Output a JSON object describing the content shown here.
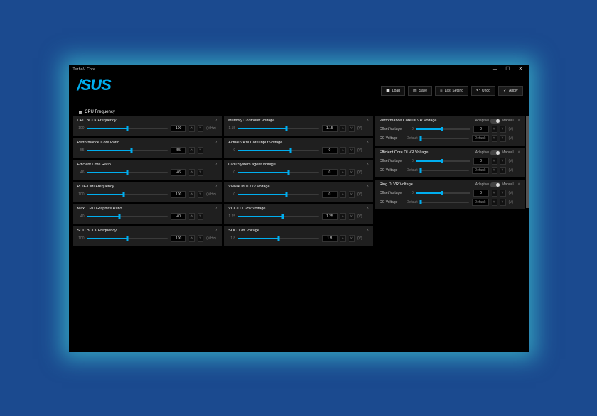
{
  "window": {
    "title": "TurboV Core"
  },
  "logo_text": "/SUS",
  "toolbar": {
    "load": "Load",
    "save": "Save",
    "last_setting": "Last Setting",
    "undo": "Undo",
    "apply": "Apply"
  },
  "tabs": {
    "cpu_freq": "CPU Frequency"
  },
  "units": {
    "mhz": "(MHz)",
    "v": "(V)"
  },
  "col1": [
    {
      "title": "CPU BCLK Frequency",
      "min": "100",
      "val": "100",
      "fill": 50,
      "unit": "(MHz)"
    },
    {
      "title": "Performance Core Ratio",
      "min": "55",
      "val": "55",
      "fill": 55,
      "unit": ""
    },
    {
      "title": "Efficient Core Ratio",
      "min": "46",
      "val": "46",
      "fill": 50,
      "unit": ""
    },
    {
      "title": "PCIE/DMI Frequency",
      "min": "100",
      "val": "100",
      "fill": 45,
      "unit": "(MHz)"
    },
    {
      "title": "Max. CPU Graphics Ratio",
      "min": "40",
      "val": "40",
      "fill": 40,
      "unit": ""
    },
    {
      "title": "SOC BCLK Frequency",
      "min": "100",
      "val": "100",
      "fill": 50,
      "unit": "(MHz)"
    }
  ],
  "col2": [
    {
      "title": "Memory Controller Voltage",
      "min": "1.15",
      "val": "1.15",
      "fill": 60,
      "unit": "(V)"
    },
    {
      "title": "Actual VRM Core Input Voltage",
      "min": "0",
      "val": "0",
      "fill": 65,
      "unit": "(V)"
    },
    {
      "title": "CPU System agent Voltage",
      "min": "0",
      "val": "0",
      "fill": 62,
      "unit": "(V)"
    },
    {
      "title": "VNNAON 0.77v Voltage",
      "min": "0",
      "val": "0",
      "fill": 60,
      "unit": "(V)"
    },
    {
      "title": "VCCIO 1.25v Voltage",
      "min": "1.25",
      "val": "1.25",
      "fill": 55,
      "unit": "(V)"
    },
    {
      "title": "SOC 1.8v Voltage",
      "min": "1.8",
      "val": "1.8",
      "fill": 50,
      "unit": "(V)"
    }
  ],
  "col3": [
    {
      "title": "Performance Core DLVR Voltage",
      "mode_left": "Adaptive",
      "mode_right": "Manual",
      "rows": [
        {
          "label": "Offset Voltage",
          "val": "0",
          "fill": 48,
          "unit": "(V)"
        },
        {
          "label": "OC Voltage",
          "default": "Default",
          "unit": "(V)"
        }
      ]
    },
    {
      "title": "Efficient Core DLVR Voltage",
      "mode_left": "Adaptive",
      "mode_right": "Manual",
      "rows": [
        {
          "label": "Offset Voltage",
          "val": "0",
          "fill": 48,
          "unit": "(V)"
        },
        {
          "label": "OC Voltage",
          "default": "Default",
          "unit": "(V)"
        }
      ]
    },
    {
      "title": "Ring DLVR Voltage",
      "mode_left": "Adaptive",
      "mode_right": "Manual",
      "rows": [
        {
          "label": "Offset Voltage",
          "val": "0",
          "fill": 48,
          "unit": "(V)"
        },
        {
          "label": "OC Voltage",
          "default": "Default",
          "unit": "(V)"
        }
      ]
    }
  ],
  "labels": {
    "default": "Default",
    "chev_up": "˄",
    "chev_down": "˅",
    "caret": "˄"
  }
}
